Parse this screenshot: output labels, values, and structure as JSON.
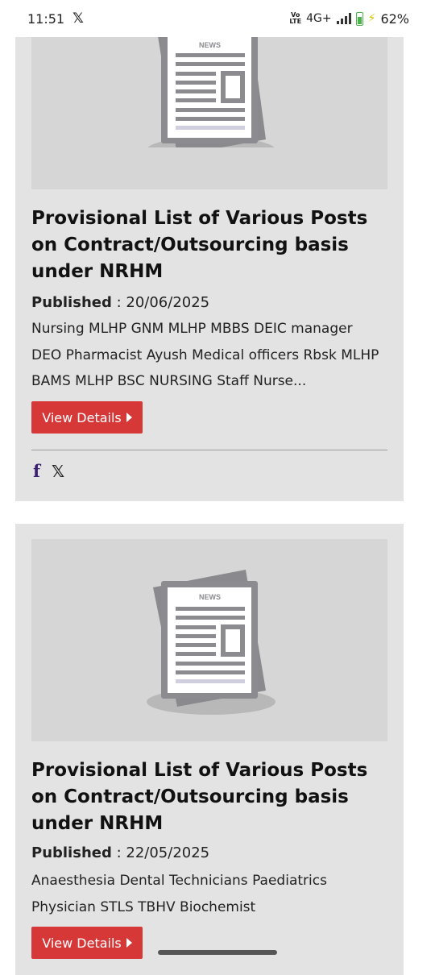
{
  "status_bar": {
    "time": "11:51",
    "app_icon": "x-logo",
    "volte": "Vo)\nLTE",
    "network": "4G+",
    "battery": "62%"
  },
  "cards": [
    {
      "image_label": "NEWS",
      "title": "Provisional List of Various Posts on Contract/Outsourcing basis under NRHM",
      "published_label": "Published",
      "published_sep": " : ",
      "published_date": "20/06/2025",
      "summary": "Nursing MLHP GNM MLHP MBBS DEIC manager DEO Pharmacist Ayush Medical officers Rbsk MLHP BAMS MLHP BSC NURSING Staff Nurse...",
      "button_label": "View Details",
      "share_facebook": "f",
      "share_x": "𝕏"
    },
    {
      "image_label": "NEWS",
      "title": "Provisional List of Various Posts on Contract/Outsourcing basis under NRHM",
      "published_label": "Published",
      "published_sep": " : ",
      "published_date": "22/05/2025",
      "summary": "Anaesthesia Dental Technicians Paediatrics Physician STLS TBHV Biochemist",
      "button_label": "View Details"
    }
  ]
}
